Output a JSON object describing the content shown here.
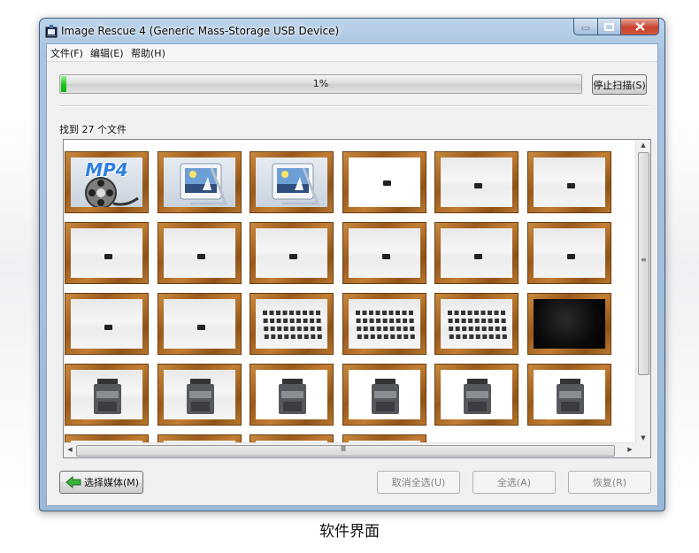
{
  "window": {
    "title": "Image Rescue 4 (Generic Mass-Storage USB Device)"
  },
  "menu": [
    {
      "label": "文件(F)"
    },
    {
      "label": "编辑(E)"
    },
    {
      "label": "帮助(H)"
    }
  ],
  "scan": {
    "progress_percent": 1,
    "progress_text": "1%",
    "stop_label": "停止扫描(S)"
  },
  "results": {
    "found_text": "找到 27 个文件"
  },
  "thumbnails": [
    {
      "kind": "mp4-file-icon"
    },
    {
      "kind": "generic-image-icon"
    },
    {
      "kind": "generic-image-icon"
    },
    {
      "kind": "white"
    },
    {
      "kind": "photo"
    },
    {
      "kind": "photo"
    },
    {
      "kind": "photo"
    },
    {
      "kind": "photo"
    },
    {
      "kind": "photo"
    },
    {
      "kind": "photo"
    },
    {
      "kind": "photo"
    },
    {
      "kind": "photo"
    },
    {
      "kind": "photo"
    },
    {
      "kind": "photo"
    },
    {
      "kind": "cards-grid"
    },
    {
      "kind": "cards-grid"
    },
    {
      "kind": "cards-grid"
    },
    {
      "kind": "dark"
    },
    {
      "kind": "device"
    },
    {
      "kind": "device"
    },
    {
      "kind": "device"
    },
    {
      "kind": "device"
    },
    {
      "kind": "device"
    },
    {
      "kind": "device"
    },
    {
      "kind": "partial"
    },
    {
      "kind": "partial"
    },
    {
      "kind": "partial"
    },
    {
      "kind": "partial"
    }
  ],
  "mp4_label": "MP4",
  "footer": {
    "select_media_label": "选择媒体(M)",
    "deselect_all_label": "取消全选(U)",
    "select_all_label": "全选(A)",
    "recover_label": "恢复(R)"
  },
  "caption": "软件界面",
  "colors": {
    "progress": "#17c517",
    "frame": "#a86a26",
    "titlebar": "#a9c4e0",
    "close": "#c7412c"
  }
}
